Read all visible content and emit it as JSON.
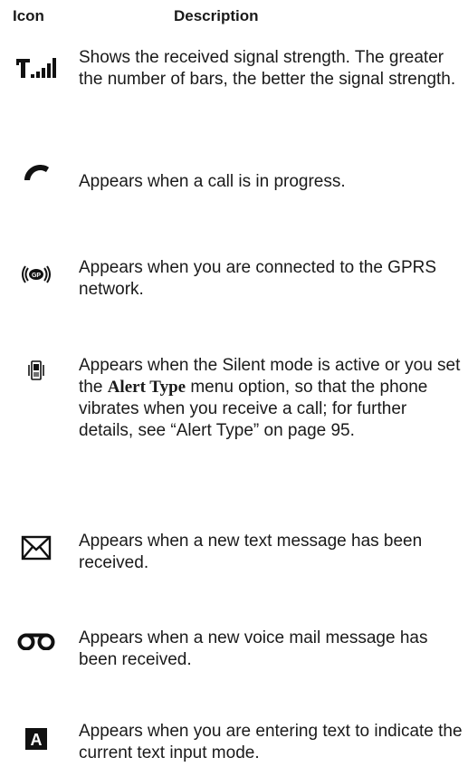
{
  "header": {
    "icon_label": "Icon",
    "description_label": "Description"
  },
  "rows": [
    {
      "icon": "signal-strength-icon",
      "description": "Shows the received signal strength. The greater the number of bars, the better the signal strength."
    },
    {
      "icon": "call-in-progress-icon",
      "description": "Appears when a call is in progress."
    },
    {
      "icon": "gprs-icon",
      "description": "Appears when you are connected to the GPRS network."
    },
    {
      "icon": "vibrate-icon",
      "description_before": "Appears when the Silent mode is active or you set the ",
      "description_bold": "Alert Type",
      "description_after": " menu option, so that the phone vibrates when you receive a call; for further details, see “Alert Type” on page 95."
    },
    {
      "icon": "text-message-icon",
      "description": "Appears when a new text message has been received."
    },
    {
      "icon": "voicemail-icon",
      "description": "Appears when a new voice mail message has been received."
    },
    {
      "icon": "text-input-mode-icon",
      "icon_text": "A",
      "description": "Appears when you are entering text to indicate the current text input mode."
    }
  ]
}
